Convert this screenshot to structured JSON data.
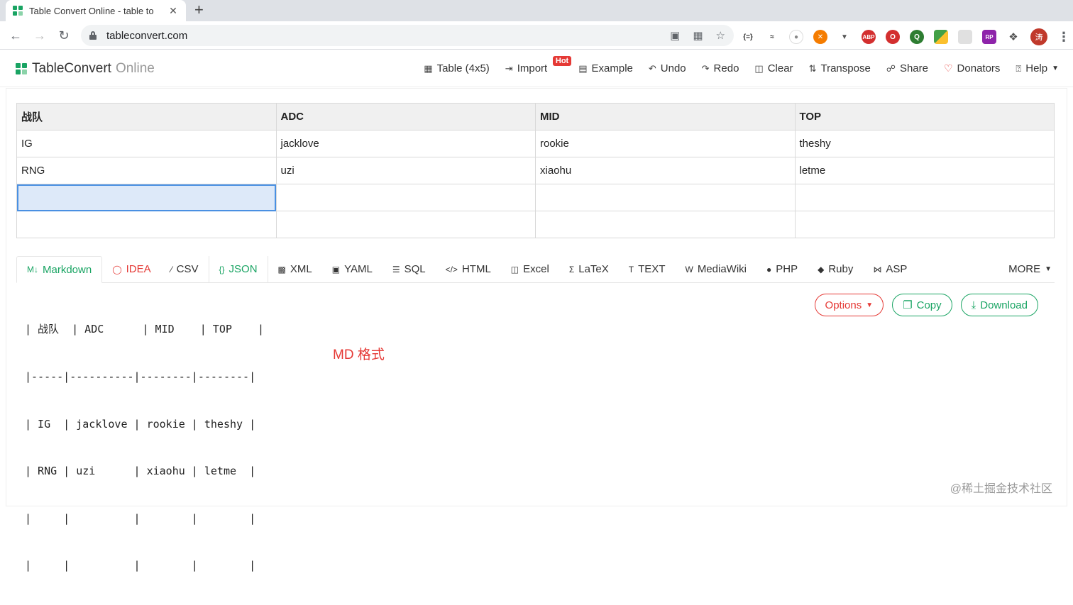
{
  "browser": {
    "tab_title": "Table Convert Online - table to",
    "tab_close": "✕",
    "new_tab": "+",
    "url": "tableconvert.com",
    "avatar_text": "涛"
  },
  "app": {
    "brand_main": "TableConvert",
    "brand_sub": "Online",
    "nav": [
      {
        "label": "Table (4x5)",
        "icon": "table-icon"
      },
      {
        "label": "Import",
        "icon": "import-icon",
        "badge": "Hot"
      },
      {
        "label": "Example",
        "icon": "example-icon"
      },
      {
        "label": "Undo",
        "icon": "undo-icon"
      },
      {
        "label": "Redo",
        "icon": "redo-icon"
      },
      {
        "label": "Clear",
        "icon": "trash-icon"
      },
      {
        "label": "Transpose",
        "icon": "transpose-icon"
      },
      {
        "label": "Share",
        "icon": "share-icon"
      },
      {
        "label": "Donators",
        "icon": "heart-icon"
      },
      {
        "label": "Help",
        "icon": "help-icon"
      }
    ]
  },
  "table": {
    "header": [
      "战队",
      "ADC",
      "MID",
      "TOP"
    ],
    "rows": [
      [
        "IG",
        "jacklove",
        "rookie",
        "theshy"
      ],
      [
        "RNG",
        "uzi",
        "xiaohu",
        "letme"
      ],
      [
        "",
        "",
        "",
        ""
      ],
      [
        "",
        "",
        "",
        ""
      ]
    ]
  },
  "formats": {
    "tabs": [
      "Markdown",
      "IDEA",
      "CSV",
      "JSON",
      "XML",
      "YAML",
      "SQL",
      "HTML",
      "Excel",
      "LaTeX",
      "TEXT",
      "MediaWiki",
      "PHP",
      "Ruby",
      "ASP"
    ],
    "active": "Markdown",
    "more": "MORE"
  },
  "output": {
    "lines": [
      "| 战队  | ADC      | MID    | TOP    |",
      "|-----|----------|--------|--------|",
      "| IG  | jacklove | rookie | theshy |",
      "| RNG | uzi      | xiaohu | letme  |",
      "|     |          |        |        |",
      "|     |          |        |        |"
    ],
    "annotation": "MD 格式"
  },
  "actions": {
    "options": "Options",
    "copy": "Copy",
    "download": "Download"
  },
  "watermark": "@稀土掘金技术社区",
  "colors": {
    "accent_green": "#19a463",
    "accent_red": "#e53935",
    "selection_blue": "#4a90e2"
  }
}
